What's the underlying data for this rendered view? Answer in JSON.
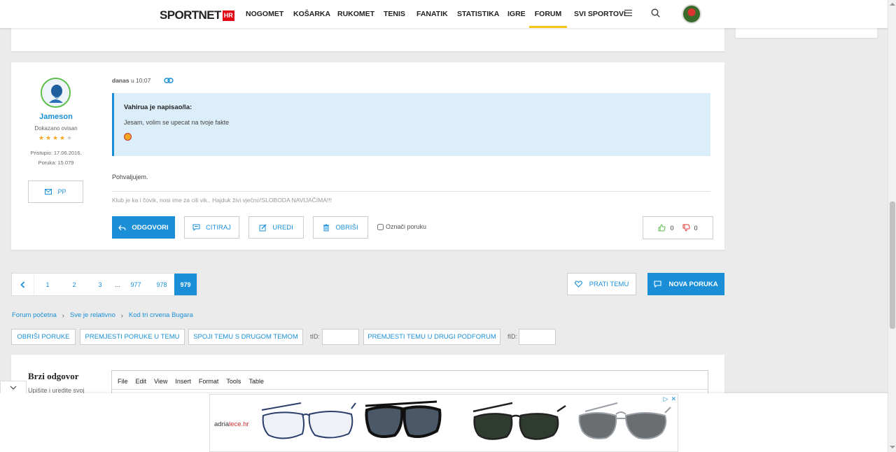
{
  "nav": {
    "logo_text": "SPORTNET",
    "logo_badge": "HR",
    "items": [
      "NOGOMET",
      "KOŠARKA",
      "RUKOMET",
      "TENIS",
      "FANATIK",
      "STATISTIKA",
      "IGRE",
      "FORUM",
      "SVI SPORTOVI"
    ],
    "active": "FORUM"
  },
  "post": {
    "username": "Jameson",
    "rank": "Dokazano ovisan",
    "stars_filled": 4,
    "stars_total": 5,
    "joined": "Pristupio: 17.06.2016.",
    "posts": "Poruka: 15.079",
    "pm_label": "PP",
    "date_day": "danas",
    "date_time": "u 10:07",
    "quote_author": "Vahirua je napisao/la:",
    "quote_text": "Jesam, volim se upecat na tvoje fakte",
    "text": "Pohvaljujem.",
    "signature": "Klub je ka i čovik, nosi ime za cili vik.. Hajduk živi vječno!SLOBODA NAVIJAČIMA!!!",
    "actions": {
      "reply": "ODGOVORI",
      "quote": "CITIRAJ",
      "edit": "UREDI",
      "delete": "OBRIŠI",
      "mark": "Označi poruku"
    },
    "likes": "0",
    "dislikes": "0"
  },
  "pagination": {
    "pages": [
      "1",
      "2",
      "3",
      "...",
      "977",
      "978",
      "979"
    ],
    "current": "979",
    "follow_label": "PRATI TEMU",
    "new_post_label": "NOVA PORUKA"
  },
  "breadcrumb": [
    "Forum početna",
    "Sve je relativno",
    "Kod tri crvena Bugara"
  ],
  "mod": {
    "delete_posts": "OBRIŠI PORUKE",
    "move_posts": "PREMJESTI PORUKE U TEMU",
    "merge_topic": "SPOJI TEMU S DRUGOM TEMOM",
    "tid_label": "tID:",
    "move_topic": "PREMJESTI TEMU U DRUGI PODFORUM",
    "fid_label": "fID:"
  },
  "reply": {
    "title": "Brzi odgovor",
    "subtitle": "Upišite i uredite svoj",
    "editor_menu": [
      "File",
      "Edit",
      "View",
      "Insert",
      "Format",
      "Tools",
      "Table"
    ]
  },
  "ad": {
    "brand_prefix": "adria",
    "brand_suffix": "lece.hr"
  },
  "colors": {
    "accent": "#1a8fd8",
    "active_underline": "#f5c518",
    "logo_red": "#e30613",
    "like_green": "#5cbf4a",
    "dislike_red": "#e53935"
  }
}
